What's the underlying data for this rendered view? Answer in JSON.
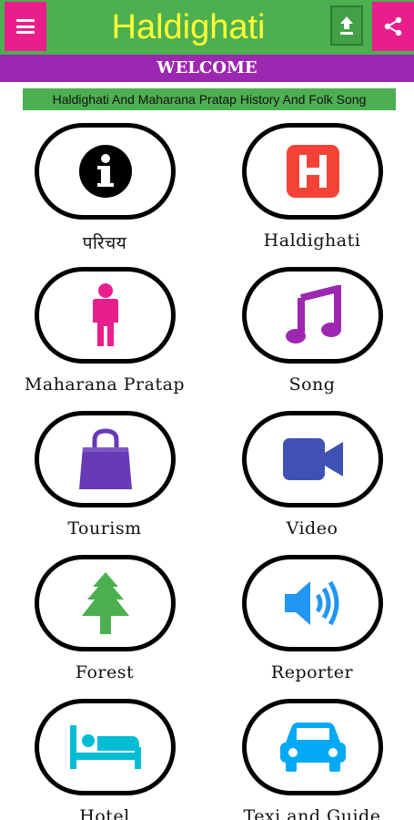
{
  "header": {
    "title": "Haldighati",
    "menu_icon": "hamburger-menu-icon",
    "upload_icon": "upload-icon",
    "share_icon": "share-icon",
    "colors": {
      "bar": "#4caf50",
      "buttons": "#e91e8c",
      "title": "#ffff33"
    }
  },
  "welcome": {
    "text": "WELCOME",
    "color": "#9c27b0"
  },
  "marquee": {
    "text": "Haldighati And Maharana Pratap History And Folk Song"
  },
  "tiles": [
    {
      "label": "परिचय",
      "icon": "info-icon"
    },
    {
      "label": "Haldighati",
      "icon": "hospital-h-icon"
    },
    {
      "label": "Maharana Pratap",
      "icon": "person-icon"
    },
    {
      "label": "Song",
      "icon": "music-note-icon"
    },
    {
      "label": "Tourism",
      "icon": "shopping-bag-icon"
    },
    {
      "label": "Video",
      "icon": "video-camera-icon"
    },
    {
      "label": "Forest",
      "icon": "tree-icon"
    },
    {
      "label": "Reporter",
      "icon": "speaker-icon"
    },
    {
      "label": "Hotel",
      "icon": "bed-icon"
    },
    {
      "label": "Texi and Guide",
      "icon": "car-icon"
    }
  ]
}
